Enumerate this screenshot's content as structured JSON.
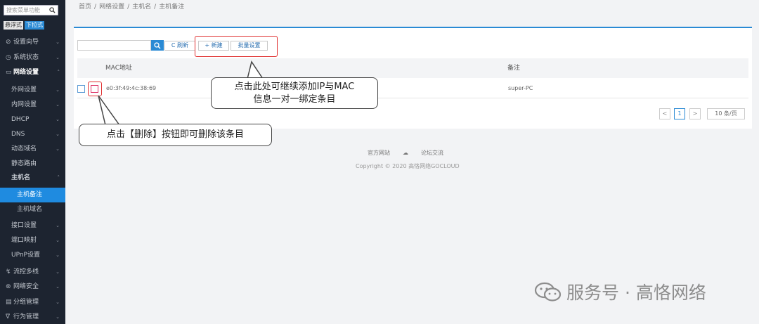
{
  "sidebar": {
    "search_placeholder": "搜索菜单功能",
    "modes": [
      "悬浮式",
      "下拉式"
    ],
    "items": [
      {
        "label": "设置向导",
        "glyph": "⊘",
        "chev": "⌄"
      },
      {
        "label": "系统状态",
        "glyph": "◷",
        "chev": "⌄"
      },
      {
        "label": "网络设置",
        "glyph": "▭",
        "chev": "˄"
      },
      {
        "label": "外网设置",
        "chev": "⌄"
      },
      {
        "label": "内网设置",
        "chev": "⌄"
      },
      {
        "label": "DHCP",
        "chev": "⌄"
      },
      {
        "label": "DNS",
        "chev": "⌄"
      },
      {
        "label": "动态域名",
        "chev": "⌄"
      },
      {
        "label": "静态路由",
        "chev": ""
      },
      {
        "label": "主机名",
        "chev": "˄"
      },
      {
        "label": "主机备注"
      },
      {
        "label": "主机域名"
      },
      {
        "label": "接口设置",
        "chev": "⌄"
      },
      {
        "label": "端口映射",
        "chev": "⌄"
      },
      {
        "label": "UPnP设置",
        "chev": "⌄"
      },
      {
        "label": "流控多线",
        "glyph": "↯",
        "chev": "⌄"
      },
      {
        "label": "网络安全",
        "glyph": "⊛",
        "chev": "⌄"
      },
      {
        "label": "分组管理",
        "glyph": "▤",
        "chev": "⌄"
      },
      {
        "label": "行为管理",
        "glyph": "∇",
        "chev": "⌄"
      }
    ]
  },
  "breadcrumb": [
    "首页",
    "/",
    "网络设置",
    "/",
    "主机名",
    "/",
    "主机备注"
  ],
  "toolbar": {
    "refresh_label": "C 刷新",
    "new_label": "+ 新建",
    "batch_label": "批量设置"
  },
  "table": {
    "headers": [
      "MAC地址",
      "备注"
    ],
    "rows": [
      {
        "mac": "e0:3f:49:4c:38:69",
        "remark": "super-PC"
      }
    ]
  },
  "pagination": {
    "prev": "<",
    "current": "1",
    "next": ">",
    "page_size": "10 条/页"
  },
  "footer": {
    "link1": "官方网站",
    "cloud": "☁",
    "link2": "论坛交流",
    "copyright": "Copyright © 2020 高恪网络GOCLOUD"
  },
  "callouts": {
    "add_line1": "点击此处可继续添加IP与MAC",
    "add_line2": "信息一对一绑定条目",
    "delete": "点击【删除】按钮即可删除该条目"
  },
  "watermark": "服务号 · 高恪网络",
  "colors": {
    "accent": "#2a8ad4",
    "sidebar_bg": "#1d2430",
    "highlight": "#e03030"
  }
}
